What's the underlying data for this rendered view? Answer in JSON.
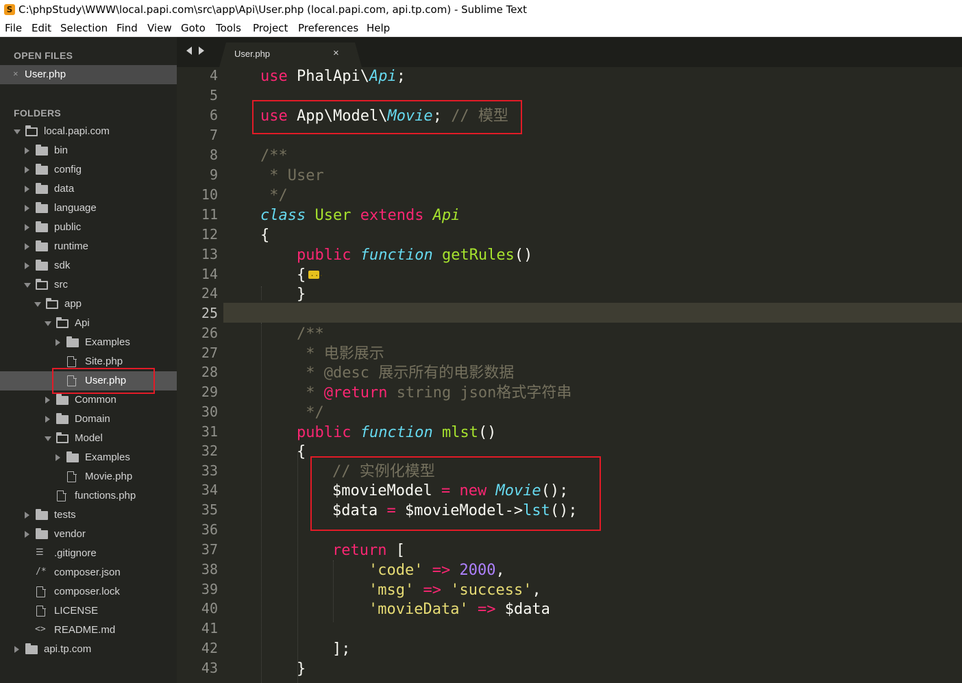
{
  "window": {
    "title": "C:\\phpStudy\\WWW\\local.papi.com\\src\\app\\Api\\User.php (local.papi.com, api.tp.com) - Sublime Text",
    "app_icon_letter": "S"
  },
  "menu": [
    "File",
    "Edit",
    "Selection",
    "Find",
    "View",
    "Goto",
    "Tools",
    "Project",
    "Preferences",
    "Help"
  ],
  "sidebar": {
    "open_files_heading": "OPEN FILES",
    "open_files": [
      {
        "label": "User.php",
        "close": "×"
      }
    ],
    "folders_heading": "FOLDERS",
    "tree": [
      {
        "label": "local.papi.com",
        "kind": "folder",
        "expanded": true
      },
      {
        "label": "bin",
        "kind": "folder"
      },
      {
        "label": "config",
        "kind": "folder"
      },
      {
        "label": "data",
        "kind": "folder"
      },
      {
        "label": "language",
        "kind": "folder"
      },
      {
        "label": "public",
        "kind": "folder"
      },
      {
        "label": "runtime",
        "kind": "folder"
      },
      {
        "label": "sdk",
        "kind": "folder"
      },
      {
        "label": "src",
        "kind": "folder",
        "expanded": true
      },
      {
        "label": "app",
        "kind": "folder",
        "expanded": true
      },
      {
        "label": "Api",
        "kind": "folder",
        "expanded": true
      },
      {
        "label": "Examples",
        "kind": "folder"
      },
      {
        "label": "Site.php",
        "kind": "file"
      },
      {
        "label": "User.php",
        "kind": "file",
        "selected": true
      },
      {
        "label": "Common",
        "kind": "folder"
      },
      {
        "label": "Domain",
        "kind": "folder"
      },
      {
        "label": "Model",
        "kind": "folder",
        "expanded": true
      },
      {
        "label": "Examples",
        "kind": "folder"
      },
      {
        "label": "Movie.php",
        "kind": "file"
      },
      {
        "label": "functions.php",
        "kind": "file"
      },
      {
        "label": "tests",
        "kind": "folder"
      },
      {
        "label": "vendor",
        "kind": "folder"
      },
      {
        "label": ".gitignore",
        "kind": "list-file",
        "glyph": "☰"
      },
      {
        "label": "composer.json",
        "kind": "comment-file",
        "glyph": "/*"
      },
      {
        "label": "composer.lock",
        "kind": "file"
      },
      {
        "label": "LICENSE",
        "kind": "file"
      },
      {
        "label": "README.md",
        "kind": "markup-file",
        "glyph": "<>"
      },
      {
        "label": "api.tp.com",
        "kind": "folder"
      }
    ]
  },
  "tabs": [
    {
      "label": "User.php",
      "close": "×"
    }
  ],
  "editor": {
    "line_numbers": [
      "4",
      "5",
      "6",
      "7",
      "8",
      "9",
      "10",
      "11",
      "12",
      "13",
      "14",
      "24",
      "25",
      "26",
      "27",
      "28",
      "29",
      "30",
      "31",
      "32",
      "33",
      "34",
      "35",
      "36",
      "37",
      "38",
      "39",
      "40",
      "41",
      "42",
      "43"
    ],
    "active_line": "25",
    "code": {
      "l4": [
        "use",
        " PhalApi\\",
        "Api",
        ";"
      ],
      "l6": [
        "use",
        " App\\Model\\",
        "Movie",
        "; ",
        "// 模型"
      ],
      "l8": [
        "/**"
      ],
      "l9": [
        " * User"
      ],
      "l10": [
        " */"
      ],
      "l11": [
        "class",
        " ",
        "User",
        " ",
        "extends",
        " ",
        "Api"
      ],
      "l12": [
        "{"
      ],
      "l13": [
        "public",
        " ",
        "function",
        " ",
        "getRules",
        "()"
      ],
      "l14": [
        "{"
      ],
      "l24": [
        "}"
      ],
      "l26": [
        "/**"
      ],
      "l27": [
        " * 电影展示"
      ],
      "l28": [
        " * ",
        "@desc",
        " 展示所有的电影数据"
      ],
      "l29": [
        " * ",
        "@return",
        " string json格式字符串"
      ],
      "l30": [
        " */"
      ],
      "l31": [
        "public",
        " ",
        "function",
        " ",
        "mlst",
        "()"
      ],
      "l32": [
        "{"
      ],
      "l33": [
        "// 实例化模型"
      ],
      "l34": [
        "$movieModel ",
        "=",
        " ",
        "new",
        " ",
        "Movie",
        "();"
      ],
      "l35": [
        "$data ",
        "=",
        " $movieModel->",
        "lst",
        "();"
      ],
      "l37": [
        "return",
        " ["
      ],
      "l38": [
        "'code'",
        " ",
        "=>",
        " ",
        "2000",
        ","
      ],
      "l39": [
        "'msg'",
        " ",
        "=>",
        " ",
        "'success'",
        ","
      ],
      "l40": [
        "'movieData'",
        " ",
        "=>",
        " $data"
      ],
      "l42": [
        "];"
      ],
      "l43": [
        "}"
      ]
    }
  },
  "colors": {
    "editor_bg": "#272822",
    "sidebar_bg": "#232420",
    "keyword": "#f92672",
    "storage": "#66d9ef",
    "entity": "#a6e22e",
    "comment": "#75715e",
    "string": "#e6db74",
    "number": "#ae81ff",
    "highlight_box": "#e21b27"
  }
}
